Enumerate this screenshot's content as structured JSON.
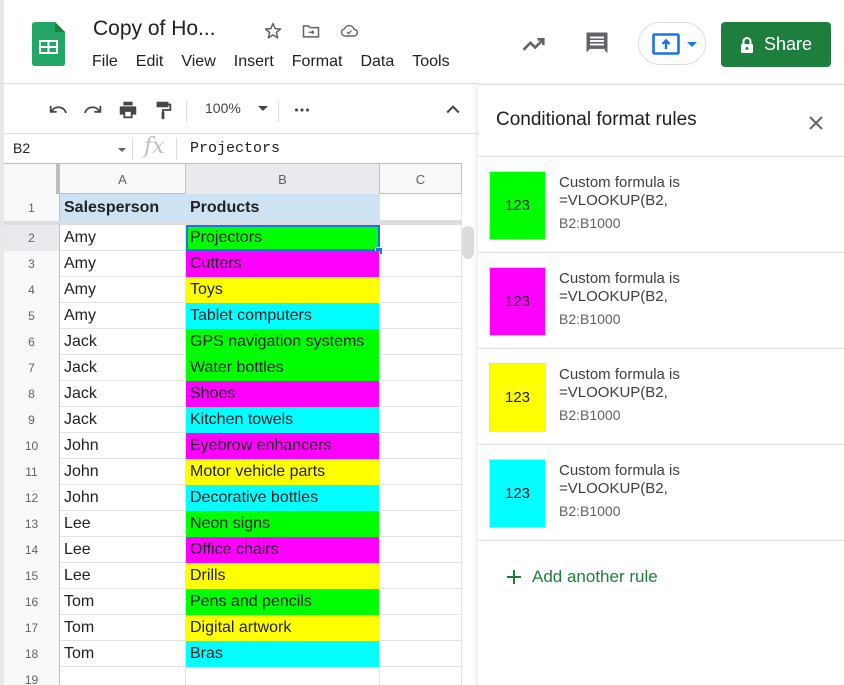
{
  "header": {
    "doc_title": "Copy of Ho...",
    "menu": [
      "File",
      "Edit",
      "View",
      "Insert",
      "Format",
      "Data",
      "Tools"
    ],
    "share_label": "Share"
  },
  "toolbar": {
    "zoom": "100%"
  },
  "formula_bar": {
    "name_box": "B2",
    "fx_label": "fx",
    "value": "Projectors"
  },
  "sheet": {
    "columns": [
      "A",
      "B",
      "C"
    ],
    "header_row": {
      "num": "1",
      "a": "Salesperson",
      "b": "Products"
    },
    "rows": [
      {
        "num": "2",
        "a": "Amy",
        "b": "Projectors",
        "color": "#00ff00"
      },
      {
        "num": "3",
        "a": "Amy",
        "b": "Cutters",
        "color": "#ff00ff"
      },
      {
        "num": "4",
        "a": "Amy",
        "b": "Toys",
        "color": "#ffff00"
      },
      {
        "num": "5",
        "a": "Amy",
        "b": "Tablet computers",
        "color": "#00ffff"
      },
      {
        "num": "6",
        "a": "Jack",
        "b": "GPS navigation systems",
        "color": "#00ff00"
      },
      {
        "num": "7",
        "a": "Jack",
        "b": "Water bottles",
        "color": "#00ff00"
      },
      {
        "num": "8",
        "a": "Jack",
        "b": "Shoes",
        "color": "#ff00ff"
      },
      {
        "num": "9",
        "a": "Jack",
        "b": "Kitchen towels",
        "color": "#00ffff"
      },
      {
        "num": "10",
        "a": "John",
        "b": "Eyebrow enhancers",
        "color": "#ff00ff"
      },
      {
        "num": "11",
        "a": "John",
        "b": "Motor vehicle parts",
        "color": "#ffff00"
      },
      {
        "num": "12",
        "a": "John",
        "b": "Decorative bottles",
        "color": "#00ffff"
      },
      {
        "num": "13",
        "a": "Lee",
        "b": "Neon signs",
        "color": "#00ff00"
      },
      {
        "num": "14",
        "a": "Lee",
        "b": "Office chairs",
        "color": "#ff00ff"
      },
      {
        "num": "15",
        "a": "Lee",
        "b": "Drills",
        "color": "#ffff00"
      },
      {
        "num": "16",
        "a": "Tom",
        "b": "Pens and pencils",
        "color": "#00ff00"
      },
      {
        "num": "17",
        "a": "Tom",
        "b": "Digital artwork",
        "color": "#ffff00"
      },
      {
        "num": "18",
        "a": "Tom",
        "b": "Bras",
        "color": "#00ffff"
      },
      {
        "num": "19",
        "a": "",
        "b": "",
        "color": ""
      }
    ]
  },
  "panel": {
    "title": "Conditional format rules",
    "rules": [
      {
        "preview": "123",
        "title": "Custom formula is",
        "formula": "=VLOOKUP(B2,",
        "range": "B2:B1000",
        "color": "#00ff00"
      },
      {
        "preview": "123",
        "title": "Custom formula is",
        "formula": "=VLOOKUP(B2,",
        "range": "B2:B1000",
        "color": "#ff00ff"
      },
      {
        "preview": "123",
        "title": "Custom formula is",
        "formula": "=VLOOKUP(B2,",
        "range": "B2:B1000",
        "color": "#ffff00"
      },
      {
        "preview": "123",
        "title": "Custom formula is",
        "formula": "=VLOOKUP(B2,",
        "range": "B2:B1000",
        "color": "#00ffff"
      }
    ],
    "add_rule_label": "Add another rule"
  },
  "colors": {
    "brand_green": "#1e7e3e",
    "selection_blue": "#1a73e8",
    "header_fill": "#cfe2f3"
  }
}
